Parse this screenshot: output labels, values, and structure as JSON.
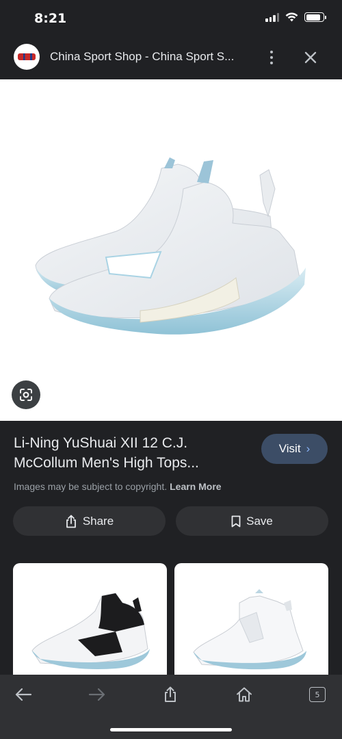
{
  "status_bar": {
    "time": "8:21"
  },
  "header": {
    "title": "China Sport Shop - China Sport S..."
  },
  "result": {
    "title": "Li-Ning YuShuai XII 12 C.J. McCollum Men's High Tops...",
    "visit_label": "Visit",
    "copyright_text": "Images may be subject to copyright.",
    "learn_more": "Learn More",
    "share_label": "Share",
    "save_label": "Save"
  },
  "toolbar": {
    "tabs_count": "5"
  },
  "colors": {
    "background": "#202124",
    "visit_button": "#3c4d66",
    "accent": "#8ab4f8"
  },
  "icons": [
    "site-logo",
    "more-vert-icon",
    "close-icon",
    "google-lens-icon",
    "chevron-right-icon",
    "share-icon",
    "bookmark-icon",
    "back-arrow-icon",
    "forward-arrow-icon",
    "share-upload-icon",
    "home-icon",
    "tabs-icon"
  ]
}
